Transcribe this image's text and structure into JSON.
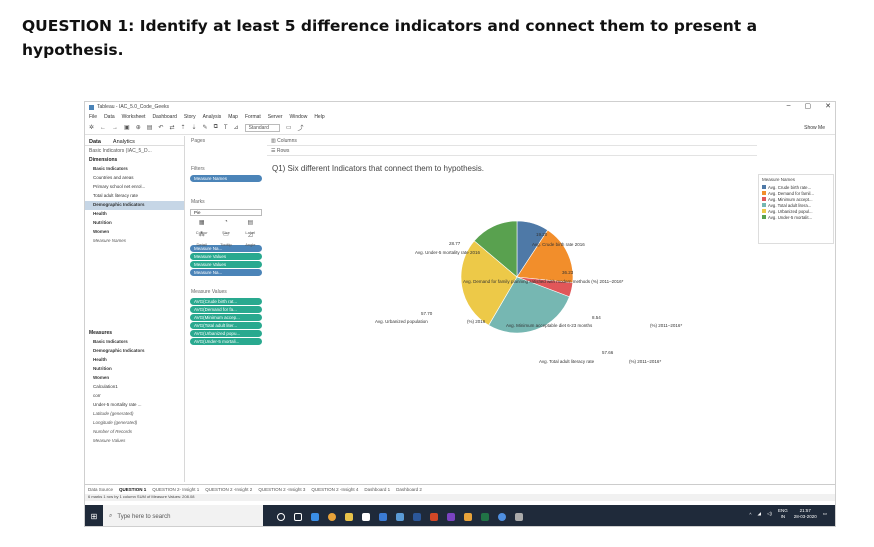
{
  "document": {
    "title": "QUESTION 1: Identify at least 5 difference indicators and connect them to present a hypothesis."
  },
  "window": {
    "title": "Tableau - IAC_5.0_Code_Geeks",
    "controls": [
      "–",
      "▢",
      "✕"
    ]
  },
  "menu": [
    "File",
    "Data",
    "Worksheet",
    "Dashboard",
    "Story",
    "Analysis",
    "Map",
    "Format",
    "Server",
    "Window",
    "Help"
  ],
  "toolbar": {
    "standard": "Standard",
    "show_me": "Show Me"
  },
  "data_pane": {
    "tabs": [
      "Data",
      "Analytics"
    ],
    "datasource": "Basic Indicators (IAC_5_D...",
    "dimensions_label": "Dimensions",
    "dimensions": [
      {
        "label": "Basic Indicators",
        "style": "bold"
      },
      {
        "label": "Countries and areas",
        "style": ""
      },
      {
        "label": "Primary school net enrol...",
        "style": ""
      },
      {
        "label": "Total adult literacy rate",
        "style": ""
      },
      {
        "label": "Demographic Indicators",
        "style": "bold sel"
      },
      {
        "label": "Health",
        "style": "bold"
      },
      {
        "label": "Nutrition",
        "style": "bold"
      },
      {
        "label": "Women",
        "style": "bold"
      },
      {
        "label": "Measure Names",
        "style": "ital"
      }
    ],
    "measures_label": "Measures",
    "measures": [
      {
        "label": "Basic Indicators",
        "style": "bold"
      },
      {
        "label": "Demographic Indicators",
        "style": "bold"
      },
      {
        "label": "Health",
        "style": "bold"
      },
      {
        "label": "Nutrition",
        "style": "bold"
      },
      {
        "label": "Women",
        "style": "bold"
      },
      {
        "label": "Calculation1",
        "style": ""
      },
      {
        "label": "corr",
        "style": ""
      },
      {
        "label": "Under-5 mortality rate ...",
        "style": ""
      },
      {
        "label": "Latitude (generated)",
        "style": "ital"
      },
      {
        "label": "Longitude (generated)",
        "style": "ital"
      },
      {
        "label": "Number of Records",
        "style": "ital"
      },
      {
        "label": "Measure Values",
        "style": "ital"
      }
    ]
  },
  "shelves": {
    "pages": "Pages",
    "filters": "Filters",
    "filter_pill": "Measure Names",
    "marks": "Marks",
    "mark_type": "Pie",
    "mark_buttons": [
      "Colour",
      "Size",
      "Label",
      "Detail",
      "Tooltip",
      "Angle"
    ],
    "mark_pills": [
      "Measure Na...",
      "Measure Values",
      "Measure Values",
      "Measure Na..."
    ],
    "measure_values_label": "Measure Values",
    "measure_values": [
      "AVG(Crude birth rat...",
      "AVG(Demand for fa...",
      "AVG(Minimum accep...",
      "AVG(Total adult liter...",
      "AVG(Urbanized popu...",
      "AVG(Under-5 mortali..."
    ],
    "columns": "Columns",
    "rows": "Rows"
  },
  "chart_data": {
    "type": "pie",
    "title": "Q1) Six different Indicators that connect them to hypothesis.",
    "slices": [
      {
        "name": "Avg. Crude birth rate 2016",
        "value": 19.2,
        "color": "#4e79a7"
      },
      {
        "name": "Avg. Demand for family planning satisfied with modern methods (%) 2011–2016*",
        "value": 36.23,
        "color": "#f28e2b"
      },
      {
        "name": "Avg. Minimum acceptable diet 6-23 months (%) 2011–2016*",
        "value": 8.54,
        "color": "#e15759"
      },
      {
        "name": "Avg. Total adult literacy rate (%) 2011–2016*",
        "value": 57.66,
        "color": "#76b7b2"
      },
      {
        "name": "Avg. Urbanized population (%) 2016",
        "value": 57.7,
        "color": "#edc948"
      },
      {
        "name": "Avg. Under-5 mortality rate 2016",
        "value": 28.77,
        "color": "#59a14f"
      }
    ],
    "labels": {
      "crude": "Avg. Crude birth rate 2016",
      "under5": "Avg. Under-5 mortality rate 2016",
      "demand": "Avg. Demand for family planning satisfied with modern methods (%) 2011–2016*",
      "minimum": "Avg. Minimum acceptable diet 6-23 months",
      "minimum_pct": "(%) 2011–2016*",
      "urban": "Avg. Urbanized population",
      "urban_pct": "(%) 2016",
      "literacy": "Avg. Total adult literacy rate",
      "literacy_pct": "(%) 2011–2016*"
    }
  },
  "legend": {
    "title": "Measure Names",
    "items": [
      {
        "label": "Avg. Crude birth rate...",
        "color": "#4e79a7"
      },
      {
        "label": "Avg. Demand for famil...",
        "color": "#f28e2b"
      },
      {
        "label": "Avg. Minimum accept...",
        "color": "#e15759"
      },
      {
        "label": "Avg. Total adult litera...",
        "color": "#76b7b2"
      },
      {
        "label": "Avg. Urbanized popul...",
        "color": "#edc948"
      },
      {
        "label": "Avg. Under-5 mortalit...",
        "color": "#59a14f"
      }
    ]
  },
  "sheet_tabs": [
    "Data Source",
    "QUESTION 1",
    "QUESTION 2- Insight 1",
    "QUESTION 2 -Insight 2",
    "QUESTION 2 -Insight 3",
    "QUESTION 2 -Insight 4",
    "Dashboard 1",
    "Dashboard 2"
  ],
  "status": "6 marks   1 row by 1 column   SUM of Measure Values: 208.08",
  "taskbar": {
    "search_placeholder": "Type here to search",
    "lang": "ENG",
    "region": "IN",
    "time": "21:57",
    "date": "28-03-2020"
  }
}
